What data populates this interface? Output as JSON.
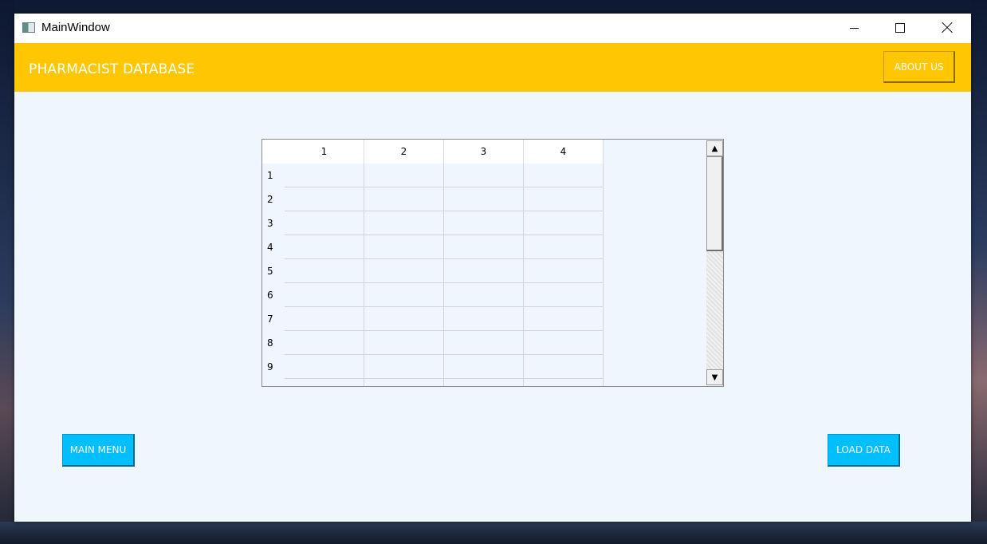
{
  "window": {
    "title": "MainWindow"
  },
  "header": {
    "title": "PHARMACIST DATABASE",
    "about_label": "ABOUT US"
  },
  "table": {
    "columns": [
      "1",
      "2",
      "3",
      "4"
    ],
    "rows": [
      "1",
      "2",
      "3",
      "4",
      "5",
      "6",
      "7",
      "8",
      "9"
    ]
  },
  "buttons": {
    "main_menu": "MAIN MENU",
    "load_data": "LOAD DATA"
  },
  "colors": {
    "header": "#ffc703",
    "button": "#00bfff",
    "background": "#eff6fd"
  }
}
